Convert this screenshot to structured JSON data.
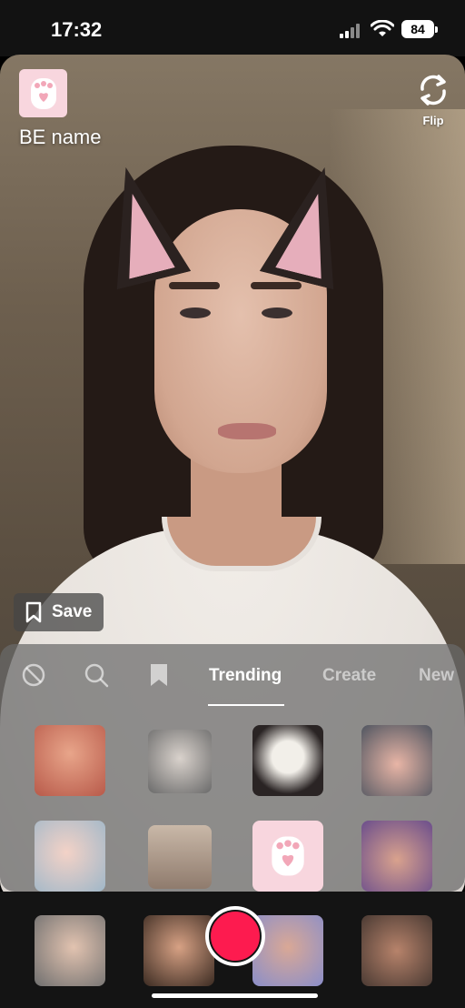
{
  "status": {
    "time": "17:32",
    "battery": "84"
  },
  "effect": {
    "name": "BE name",
    "icon": "paw-icon"
  },
  "camera": {
    "flip_label": "Flip"
  },
  "save": {
    "label": "Save"
  },
  "tabs": {
    "none_icon": "no-effect-icon",
    "search_icon": "search-icon",
    "saved_icon": "bookmark-icon",
    "items": [
      "Trending",
      "Create",
      "New"
    ],
    "active": "Trending"
  },
  "colors": {
    "record": "#fd1b4f",
    "paw_bg": "#f8d6de"
  }
}
